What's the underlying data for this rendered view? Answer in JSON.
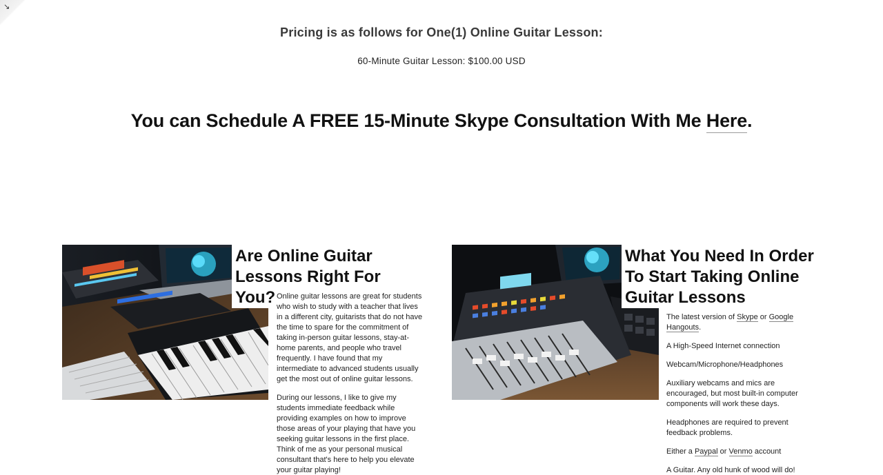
{
  "pricing": {
    "title": "Pricing is as follows for One(1) Online Guitar Lesson:",
    "line": "60-Minute Guitar Lesson: $100.00 USD"
  },
  "schedule": {
    "prefix": "You can Schedule A FREE 15-Minute Skype Consultation With Me ",
    "link": "Here",
    "suffix": "."
  },
  "card_left": {
    "title": "Are Online Guitar Lessons Right For You?",
    "paragraphs": [
      "Online guitar lessons are great for students who wish to study with a teacher that lives in a different city, guitarists that do not have the time to spare for the commitment of taking in-person guitar lessons, stay-at-home parents, and people who travel frequently. I have found that my intermediate to advanced students usually get the most out of online guitar lessons.",
      "During our lessons, I like to give my students immediate feedback while providing examples on how to improve those areas of your playing that have you seeking guitar lessons in the first place. Think of me as your personal musical consultant that's here to help you elevate your guitar playing!"
    ]
  },
  "card_right": {
    "title": "What You Need In Order To Start Taking Online Guitar Lessons",
    "item1_prefix": "The latest version of ",
    "item1_link1": "Skype",
    "item1_mid": " or ",
    "item1_link2": "Google Hangouts",
    "item1_suffix": ".",
    "item2": "A High-Speed Internet connection",
    "item3": "Webcam/Microphone/Headphones",
    "item4": "Auxiliary webcams and mics are encouraged, but most built-in computer components will work these days.",
    "item5": "Headphones are required to prevent feedback problems.",
    "item6_prefix": "Either a ",
    "item6_link1": "Paypal",
    "item6_mid": " or ",
    "item6_link2": "Venmo",
    "item6_suffix": " account",
    "item7": "A Guitar. Any old hunk of wood will do!"
  },
  "colors": {
    "heading": "#111111",
    "subheading": "#3a3a3a",
    "link_underline": "#9a9a9a",
    "background": "#ffffff"
  },
  "icons": {
    "corner": "expand-arrow-icon"
  }
}
